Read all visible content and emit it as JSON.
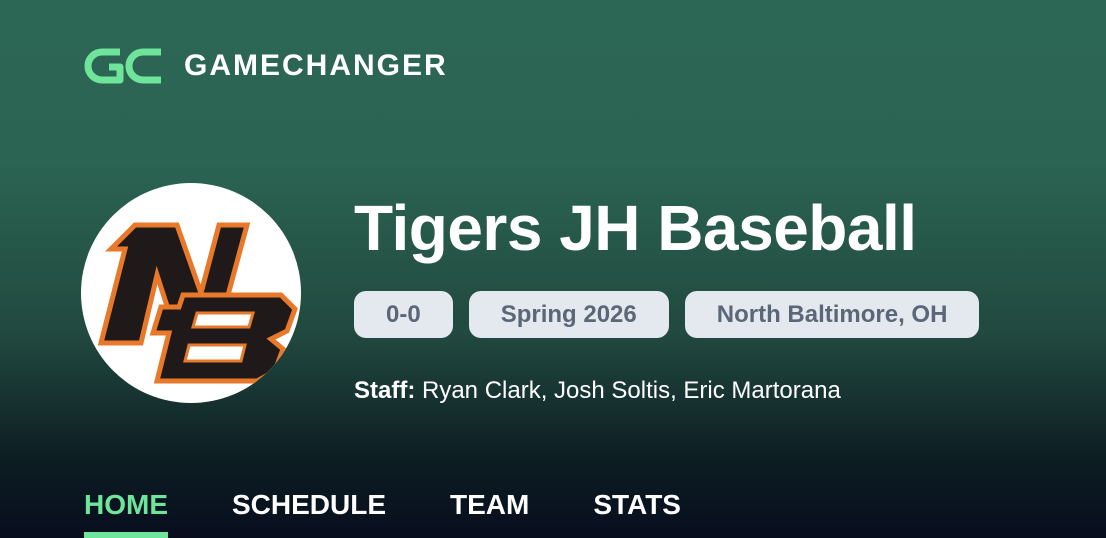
{
  "brand": {
    "mark_icon": "gamechanger-gc-logo-icon",
    "name": "GAMECHANGER",
    "accent_color": "#6ee59a"
  },
  "team": {
    "logo_icon": "nb-team-logo-icon",
    "name": "Tigers JH Baseball",
    "record": "0-0",
    "season": "Spring 2026",
    "location": "North Baltimore, OH",
    "staff_label": "Staff:",
    "staff_members": "Ryan Clark, Josh Soltis, Eric Martorana"
  },
  "nav": {
    "items": [
      {
        "label": "HOME",
        "active": true
      },
      {
        "label": "SCHEDULE",
        "active": false
      },
      {
        "label": "TEAM",
        "active": false
      },
      {
        "label": "STATS",
        "active": false
      }
    ]
  }
}
